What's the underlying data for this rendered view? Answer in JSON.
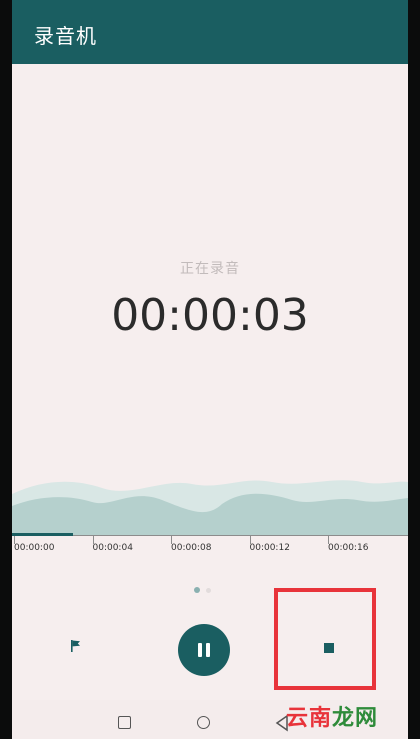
{
  "app": {
    "title": "录音机"
  },
  "recording": {
    "status": "正在录音",
    "elapsed": "00:00:03"
  },
  "timeline": {
    "progress_seconds": 3,
    "ticks": [
      "00:00:00",
      "00:00:04",
      "00:00:08",
      "00:00:12",
      "00:00:16"
    ]
  },
  "pager": {
    "pages": 2,
    "active_index": 0
  },
  "controls": {
    "flag_icon": "flag-icon",
    "pause_icon": "pause-icon",
    "stop_icon": "stop-icon"
  },
  "navbar": {
    "icons": [
      "recent-apps-icon",
      "home-icon",
      "back-icon"
    ]
  },
  "watermark": {
    "part1": "云南",
    "part2": "龙网"
  },
  "colors": {
    "accent": "#1a5e61",
    "highlight": "#e8333a",
    "background": "#f6eeee"
  }
}
